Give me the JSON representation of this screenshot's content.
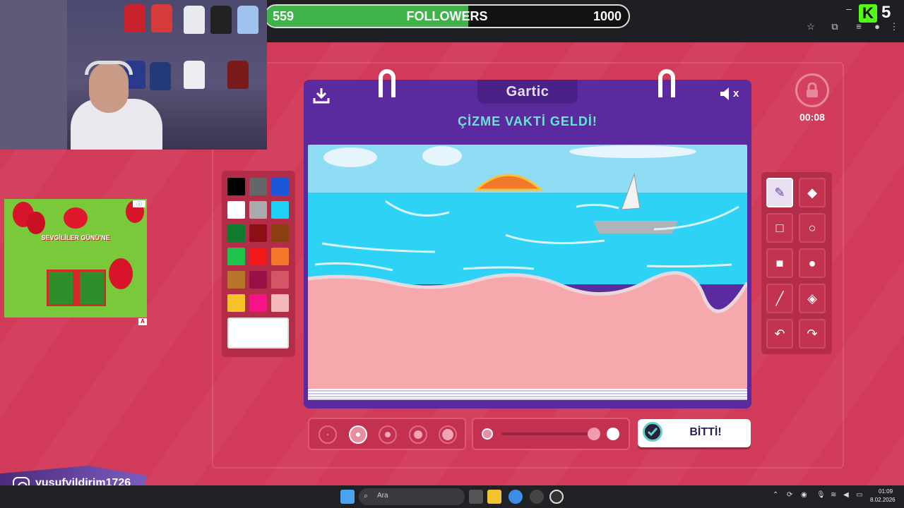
{
  "follower_goal": {
    "current": "559",
    "label": "FOLLOWERS",
    "target": "1000",
    "progress_fraction": 0.559
  },
  "stream_overlay": {
    "kick_count": "5",
    "instagram_handle": "yusufyildirim1726"
  },
  "ad": {
    "text": "SEVGİLİLER GÜNÜ'NE",
    "badge": "A"
  },
  "game": {
    "logo": "Gartic",
    "prompt": "ÇİZME VAKTİ GELDİ!",
    "mute_label": "x",
    "timer": "00:08",
    "done_button": "BİTTİ!"
  },
  "palette": {
    "colors": [
      "#000000",
      "#666666",
      "#1a56d6",
      "#ffffff",
      "#aaaaaa",
      "#1fd1f5",
      "#127a2e",
      "#8b0f14",
      "#8b3f12",
      "#1fc24a",
      "#f21818",
      "#f5782a",
      "#b8762a",
      "#9a0f46",
      "#d45566",
      "#f7c22a",
      "#f7128a",
      "#f5b8b8"
    ],
    "selected": "#ffffff"
  },
  "tools": [
    "pencil",
    "eraser",
    "rectangle-outline",
    "ellipse-outline",
    "rectangle-filled",
    "ellipse-filled",
    "line",
    "fill-bucket",
    "undo",
    "redo"
  ],
  "brush_sizes": {
    "count": 5,
    "selected_index": 1
  },
  "taskbar": {
    "search_placeholder": "Ara",
    "time": "01:09",
    "date": "8.02.2026"
  }
}
